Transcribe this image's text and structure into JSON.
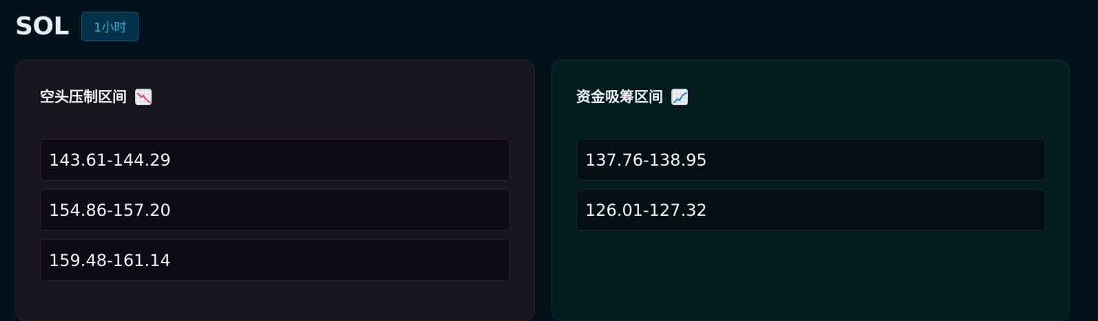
{
  "header": {
    "symbol": "SOL",
    "timeframe": "1小时"
  },
  "panels": {
    "bear": {
      "title": "空头压制区间",
      "icon": "chart-decreasing-icon",
      "levels": [
        "143.61-144.29",
        "154.86-157.20",
        "159.48-161.14"
      ]
    },
    "bull": {
      "title": "资金吸筹区间",
      "icon": "chart-increasing-icon",
      "levels": [
        "137.76-138.95",
        "126.01-127.32"
      ]
    }
  },
  "colors": {
    "background": "#02121b",
    "bear_accent": "#e0457a",
    "bull_accent": "#2f86d8",
    "badge_text": "#2fa7d6"
  }
}
